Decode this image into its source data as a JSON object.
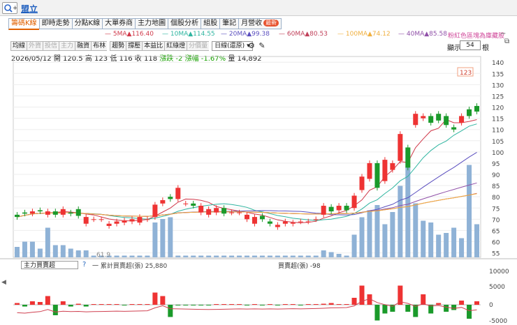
{
  "header": {
    "stock_name": "盟立"
  },
  "tabs": [
    {
      "label": "籌碼K線",
      "active": true
    },
    {
      "label": "即時走勢"
    },
    {
      "label": "分點K線"
    },
    {
      "label": "大單券商"
    },
    {
      "label": "主力地圖"
    },
    {
      "label": "個股分析"
    },
    {
      "label": "組股"
    },
    {
      "label": "筆記"
    },
    {
      "label": "月營收",
      "badge": "最新"
    }
  ],
  "ma_legend": [
    {
      "label": "5MA",
      "value": "▲116.40",
      "color": "#d0394a"
    },
    {
      "label": "10MA",
      "value": "▲114.55",
      "color": "#2fb5a0"
    },
    {
      "label": "20MA",
      "value": "▲99.38",
      "color": "#5b4fbf"
    },
    {
      "label": "60MA",
      "value": "▲80.53",
      "color": "#c0405a"
    },
    {
      "label": "100MA",
      "value": "▲74.12",
      "color": "#f0b040"
    },
    {
      "label": "40MA",
      "value": "▲85.58",
      "color": "#9050a8"
    }
  ],
  "ma_note": "粉紅色區塊為庫藏股",
  "toolbar": {
    "buttons": [
      {
        "label": "均線"
      },
      {
        "label": "外資",
        "dim": true
      },
      {
        "label": "投信",
        "dim": true
      },
      {
        "label": "主力",
        "dim": true
      },
      {
        "label": "融資"
      },
      {
        "label": "布林"
      },
      {
        "label": "趨勢",
        "sep": true
      },
      {
        "label": "撐壓"
      },
      {
        "label": "本益比"
      },
      {
        "label": "紅綠燈"
      },
      {
        "label": "分價量",
        "dim": true
      }
    ],
    "period": "日線(還原)",
    "display_label": "顯示:",
    "display_count": "54",
    "display_unit": "根"
  },
  "info": {
    "date": "2026/05/12",
    "open_label": "開",
    "open": "120.5",
    "high_label": "高",
    "high": "123",
    "low_label": "低",
    "low": "116",
    "close_label": "收",
    "close": "118",
    "change_text": "漲跌 -2",
    "change_pct_text": "漲幅 -1.67%",
    "volume_label": "量",
    "volume": "14,892"
  },
  "high_marker": "123",
  "low_marker": "61.9",
  "indicator": {
    "select_value": "主力買賣超",
    "help": "?",
    "legend1": "一 累計買賣超(張) 25,880",
    "legend2": "買賣超(張) -98"
  },
  "chart_data": {
    "type": "candlestick",
    "price_axis": {
      "ticks": [
        55,
        60,
        65,
        70,
        75,
        80,
        85,
        90,
        95,
        100,
        105,
        110,
        115,
        120,
        125,
        130,
        135,
        140
      ]
    },
    "indicator_axis": {
      "ticks": [
        "10000",
        "5000",
        "0",
        "-5000"
      ]
    },
    "candles": [
      {
        "o": 72,
        "c": 71
      },
      {
        "o": 73,
        "c": 72.5
      },
      {
        "o": 72.5,
        "c": 73.5
      },
      {
        "o": 74,
        "c": 73.5
      },
      {
        "o": 72,
        "c": 73.5
      },
      {
        "o": 73.5,
        "c": 72
      },
      {
        "o": 72,
        "c": 74.5
      },
      {
        "o": 73,
        "c": 72.5
      },
      {
        "o": 74.5,
        "c": 71.5
      },
      {
        "o": 68,
        "c": 71
      },
      {
        "o": 70,
        "c": 70
      },
      {
        "o": 70,
        "c": 70
      },
      {
        "o": 67,
        "c": 68
      },
      {
        "o": 68,
        "c": 69
      },
      {
        "o": 68.5,
        "c": 69.5
      },
      {
        "o": 69,
        "c": 70
      },
      {
        "o": 68.5,
        "c": 71
      },
      {
        "o": 70,
        "c": 70
      },
      {
        "o": 71,
        "c": 76.5
      },
      {
        "o": 77,
        "c": 78.5
      },
      {
        "o": 80,
        "c": 79
      },
      {
        "o": 79,
        "c": 84
      },
      {
        "o": 77,
        "c": 77
      },
      {
        "o": 77,
        "c": 76
      },
      {
        "o": 73,
        "c": 76
      },
      {
        "o": 72,
        "c": 74.5
      },
      {
        "o": 73,
        "c": 75
      },
      {
        "o": 75,
        "c": 72.5
      },
      {
        "o": 73,
        "c": 73
      },
      {
        "o": 73,
        "c": 73
      },
      {
        "o": 70,
        "c": 72
      },
      {
        "o": 68,
        "c": 71
      },
      {
        "o": 71.5,
        "c": 70
      },
      {
        "o": 69,
        "c": 68
      },
      {
        "o": 66.5,
        "c": 67.5
      },
      {
        "o": 68,
        "c": 69
      },
      {
        "o": 68,
        "c": 68.5
      },
      {
        "o": 69,
        "c": 69
      },
      {
        "o": 69,
        "c": 69
      },
      {
        "o": 70,
        "c": 70
      },
      {
        "o": 72,
        "c": 76
      },
      {
        "o": 75.5,
        "c": 73.5
      },
      {
        "o": 74,
        "c": 76
      },
      {
        "o": 76,
        "c": 74
      },
      {
        "o": 75,
        "c": 80.5
      },
      {
        "o": 83,
        "c": 89
      },
      {
        "o": 88,
        "c": 95
      },
      {
        "o": 95,
        "c": 84
      },
      {
        "o": 87,
        "c": 96.5
      },
      {
        "o": 92,
        "c": 95
      },
      {
        "o": 96,
        "c": 108
      },
      {
        "o": 102,
        "c": 93
      },
      {
        "o": 112,
        "c": 117
      },
      {
        "o": 115,
        "c": 116
      },
      {
        "o": 116,
        "c": 113
      },
      {
        "o": 117,
        "c": 114
      },
      {
        "o": 116,
        "c": 112
      },
      {
        "o": 111,
        "c": 110
      },
      {
        "o": 113,
        "c": 116
      },
      {
        "o": 119,
        "c": 116
      },
      {
        "o": 120.5,
        "c": 118
      }
    ],
    "volumes": [
      6,
      9,
      9,
      5,
      17,
      7,
      7,
      5,
      4,
      4,
      1,
      1,
      1,
      1,
      1,
      1,
      1,
      1,
      20,
      22,
      23,
      1,
      1,
      1,
      1,
      1,
      1,
      1,
      1,
      1,
      1,
      1,
      1,
      1,
      1,
      1,
      1,
      1,
      1,
      1,
      4,
      3,
      2,
      1,
      13,
      23,
      27,
      30,
      19,
      26,
      41,
      52,
      31,
      21,
      20,
      13,
      14,
      17,
      11,
      53,
      19
    ],
    "foreign": [
      0.05,
      -0.05,
      0.1,
      0.08,
      0.25,
      -0.3,
      0.1,
      -0.05,
      0.03,
      -0.05,
      0.02,
      0.02,
      0.02,
      0.02,
      -0.02,
      0.02,
      0.02,
      0.02,
      0.35,
      0.25,
      -0.35,
      -0.02,
      -0.02,
      -0.02,
      -0.02,
      -0.02,
      0.02,
      0.02,
      0.02,
      0.02,
      -0.02,
      0.02,
      -0.02,
      0.02,
      -0.02,
      0.02,
      0.02,
      -0.02,
      0.02,
      0.02,
      0.03,
      0.05,
      0.02,
      0.02,
      0.2,
      0.55,
      0.3,
      -0.45,
      -0.25,
      -0.2,
      0.55,
      -0.2,
      -0.35,
      0.3,
      -0.25,
      0.05,
      -0.2,
      -0.15,
      0.12,
      -0.4,
      0.1
    ]
  }
}
